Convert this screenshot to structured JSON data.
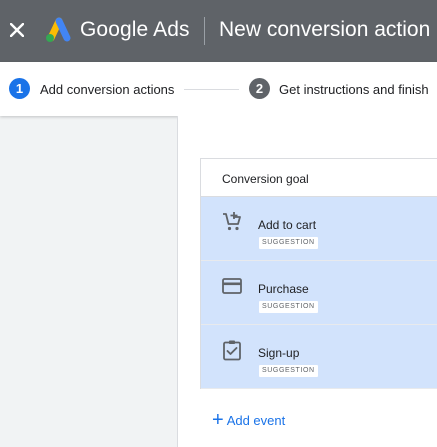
{
  "header": {
    "brand": "Google Ads",
    "title": "New conversion action"
  },
  "stepper": {
    "steps": [
      {
        "number": "1",
        "label": "Add conversion actions",
        "state": "active"
      },
      {
        "number": "2",
        "label": "Get instructions and finish",
        "state": "inactive"
      }
    ]
  },
  "card": {
    "header": "Conversion goal",
    "goals": [
      {
        "label": "Add to cart",
        "badge": "SUGGESTION",
        "icon": "cart-plus-icon"
      },
      {
        "label": "Purchase",
        "badge": "SUGGESTION",
        "icon": "credit-card-icon"
      },
      {
        "label": "Sign-up",
        "badge": "SUGGESTION",
        "icon": "clipboard-check-icon"
      }
    ]
  },
  "add_event": {
    "label": "Add event"
  },
  "colors": {
    "topbar": "#5f6368",
    "accent": "#1a73e8",
    "selected_row": "#d2e3fc"
  }
}
